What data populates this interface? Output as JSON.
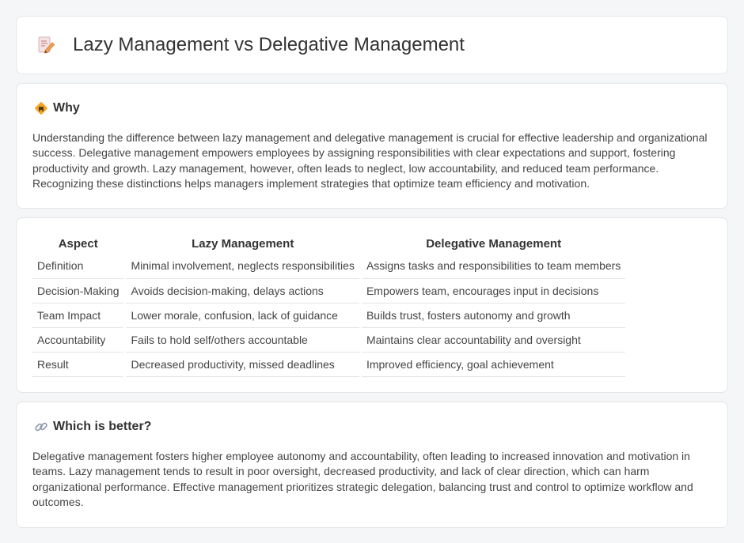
{
  "header": {
    "title": "Lazy Management vs Delegative Management",
    "icon": "document-pencil-icon"
  },
  "why": {
    "heading": "Why",
    "icon": "diamond-sign-icon",
    "text": "Understanding the difference between lazy management and delegative management is crucial for effective leadership and organizational success. Delegative management empowers employees by assigning responsibilities with clear expectations and support, fostering productivity and growth. Lazy management, however, often leads to neglect, low accountability, and reduced team performance. Recognizing these distinctions helps managers implement strategies that optimize team efficiency and motivation."
  },
  "comparison": {
    "headers": [
      "Aspect",
      "Lazy Management",
      "Delegative Management"
    ],
    "rows": [
      [
        "Definition",
        "Minimal involvement, neglects responsibilities",
        "Assigns tasks and responsibilities to team members"
      ],
      [
        "Decision-Making",
        "Avoids decision-making, delays actions",
        "Empowers team, encourages input in decisions"
      ],
      [
        "Team Impact",
        "Lower morale, confusion, lack of guidance",
        "Builds trust, fosters autonomy and growth"
      ],
      [
        "Accountability",
        "Fails to hold self/others accountable",
        "Maintains clear accountability and oversight"
      ],
      [
        "Result",
        "Decreased productivity, missed deadlines",
        "Improved efficiency, goal achievement"
      ]
    ]
  },
  "better": {
    "heading": "Which is better?",
    "icon": "link-icon",
    "text": "Delegative management fosters higher employee autonomy and accountability, often leading to increased innovation and motivation in teams. Lazy management tends to result in poor oversight, decreased productivity, and lack of clear direction, which can harm organizational performance. Effective management prioritizes strategic delegation, balancing trust and control to optimize workflow and outcomes."
  }
}
